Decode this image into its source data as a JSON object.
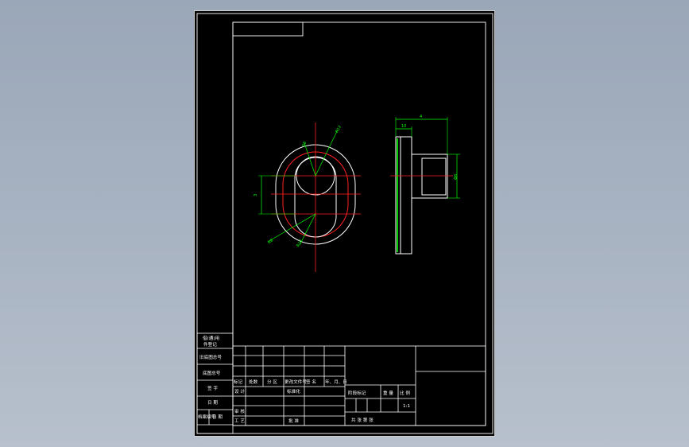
{
  "colors": {
    "background_gradient_top": "#9aa7b8",
    "sheet": "#000000",
    "frame": "#ffffff",
    "centerline": "#ff2020",
    "dimension": "#00ff00",
    "part_outline": "#ffffff"
  },
  "left_strip": {
    "cell1_line1": "借(通)用",
    "cell1_line2": "件登记",
    "cell2": "旧底图总号",
    "cell3": "底图总号",
    "cell4": "签 字",
    "cell5": "日 期",
    "cell6": "档案编号",
    "cell6_b": "日 期"
  },
  "title_block": {
    "rev_headers": [
      "标记",
      "处数",
      "分 区",
      "更改文件号",
      "签 名",
      "年、月、日"
    ],
    "designer": "设 计",
    "standardize": "标准化",
    "review": "审 核",
    "process": "工 艺",
    "approve": "批 准",
    "stage_mark": "阶段标记",
    "weight": "重 量",
    "scale_label": "比 例",
    "scale_value": "1:1",
    "sheets": "共   张   第   张"
  },
  "dimensions": {
    "front_radius_top": "R8",
    "front_radius_top2": "R12",
    "front_left_height": "3",
    "front_radius_bottom": "R8",
    "front_radius_bottom2": "R12",
    "side_total_width": "4",
    "side_flange_width": "10",
    "side_boss_dia": "Φ8"
  }
}
